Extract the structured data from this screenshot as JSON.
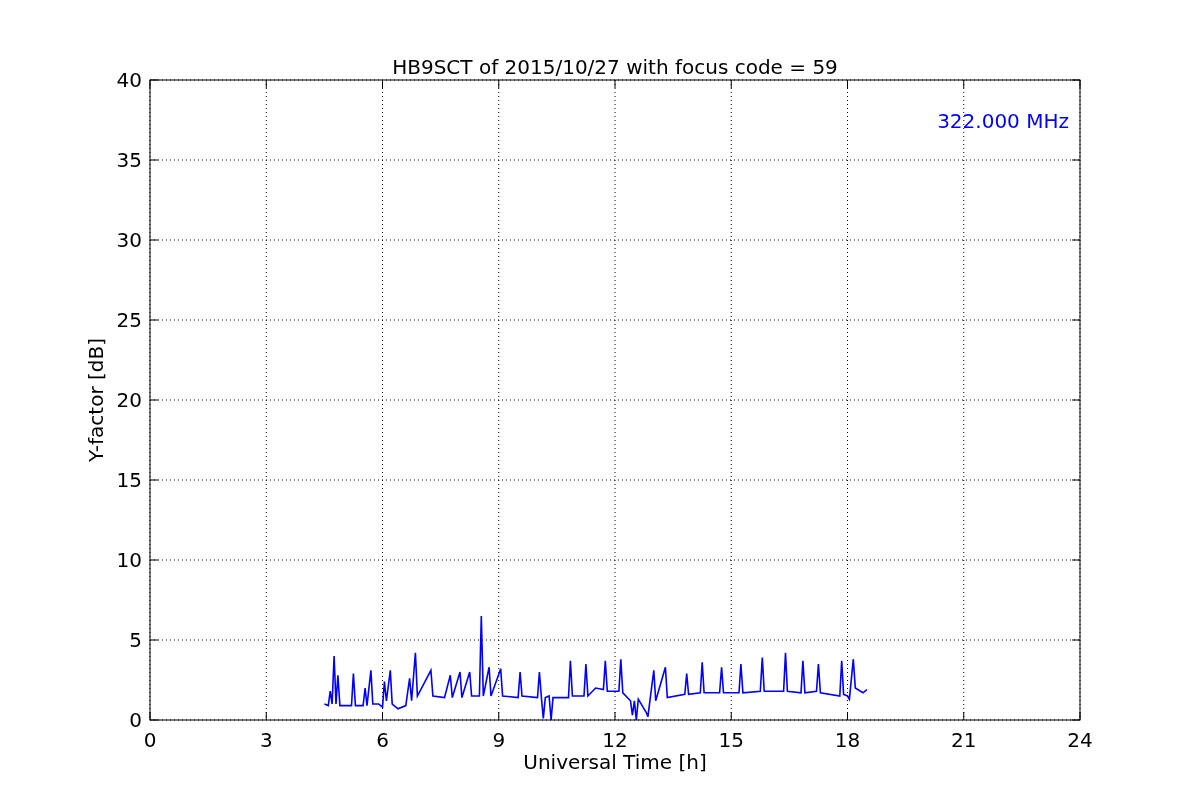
{
  "chart_data": {
    "type": "line",
    "title": "HB9SCT of 2015/10/27 with focus code = 59",
    "xlabel": "Universal Time [h]",
    "ylabel": "Y-factor [dB]",
    "xlim": [
      0,
      24
    ],
    "ylim": [
      0,
      40
    ],
    "xticks": [
      0,
      3,
      6,
      9,
      12,
      15,
      18,
      21,
      24
    ],
    "yticks": [
      0,
      5,
      10,
      15,
      20,
      25,
      30,
      35,
      40
    ],
    "x": [
      4.5,
      4.6,
      4.65,
      4.7,
      4.75,
      4.8,
      4.85,
      4.9,
      5.2,
      5.25,
      5.3,
      5.5,
      5.55,
      5.6,
      5.7,
      5.75,
      5.9,
      6.0,
      6.05,
      6.1,
      6.2,
      6.25,
      6.4,
      6.6,
      6.7,
      6.75,
      6.85,
      6.9,
      7.25,
      7.3,
      7.6,
      7.75,
      7.8,
      8.0,
      8.05,
      8.25,
      8.3,
      8.5,
      8.55,
      8.6,
      8.75,
      8.8,
      9.05,
      9.1,
      9.5,
      9.55,
      9.6,
      10.0,
      10.05,
      10.1,
      10.15,
      10.2,
      10.3,
      10.35,
      10.4,
      10.8,
      10.85,
      10.9,
      11.2,
      11.25,
      11.3,
      11.5,
      11.7,
      11.75,
      11.8,
      12.1,
      12.15,
      12.2,
      12.4,
      12.45,
      12.5,
      12.55,
      12.6,
      12.8,
      12.85,
      12.9,
      13.0,
      13.05,
      13.3,
      13.35,
      13.8,
      13.85,
      13.9,
      14.2,
      14.25,
      14.3,
      14.7,
      14.75,
      14.8,
      15.2,
      15.25,
      15.3,
      15.75,
      15.8,
      15.85,
      16.35,
      16.4,
      16.45,
      16.8,
      16.85,
      16.9,
      17.2,
      17.25,
      17.3,
      17.8,
      17.85,
      17.9,
      18.0,
      18.05,
      18.15,
      18.2,
      18.4,
      18.5
    ],
    "series": [
      {
        "color": "#0000ff",
        "values": [
          1.0,
          0.9,
          1.8,
          1.0,
          4.0,
          1.0,
          2.8,
          0.9,
          0.9,
          2.9,
          0.9,
          0.9,
          2.0,
          0.9,
          3.1,
          1.0,
          1.0,
          0.8,
          2.4,
          1.2,
          3.1,
          1.0,
          0.7,
          0.9,
          2.6,
          1.2,
          4.2,
          1.5,
          3.1,
          1.5,
          1.4,
          2.8,
          1.4,
          3.0,
          1.4,
          3.0,
          1.5,
          1.5,
          6.5,
          1.5,
          3.3,
          1.5,
          3.2,
          1.5,
          1.4,
          3.0,
          1.5,
          1.4,
          3.0,
          1.4,
          0.1,
          1.4,
          1.5,
          0.0,
          1.4,
          1.4,
          3.7,
          1.5,
          1.5,
          3.5,
          1.5,
          2.0,
          1.9,
          3.7,
          1.8,
          1.8,
          3.8,
          1.7,
          1.2,
          0.3,
          1.2,
          0.0,
          1.3,
          0.5,
          0.2,
          1.2,
          3.1,
          1.2,
          3.3,
          1.4,
          1.6,
          2.9,
          1.6,
          1.7,
          3.6,
          1.7,
          1.7,
          3.3,
          1.7,
          1.7,
          3.5,
          1.7,
          1.8,
          3.9,
          1.8,
          1.8,
          4.2,
          1.8,
          1.7,
          3.7,
          1.7,
          1.8,
          3.5,
          1.7,
          1.5,
          3.7,
          1.6,
          1.5,
          1.3,
          3.8,
          2.0,
          1.7,
          1.9
        ]
      }
    ],
    "grid": true,
    "annotations": [
      {
        "text": "322.000 MHz"
      }
    ]
  }
}
